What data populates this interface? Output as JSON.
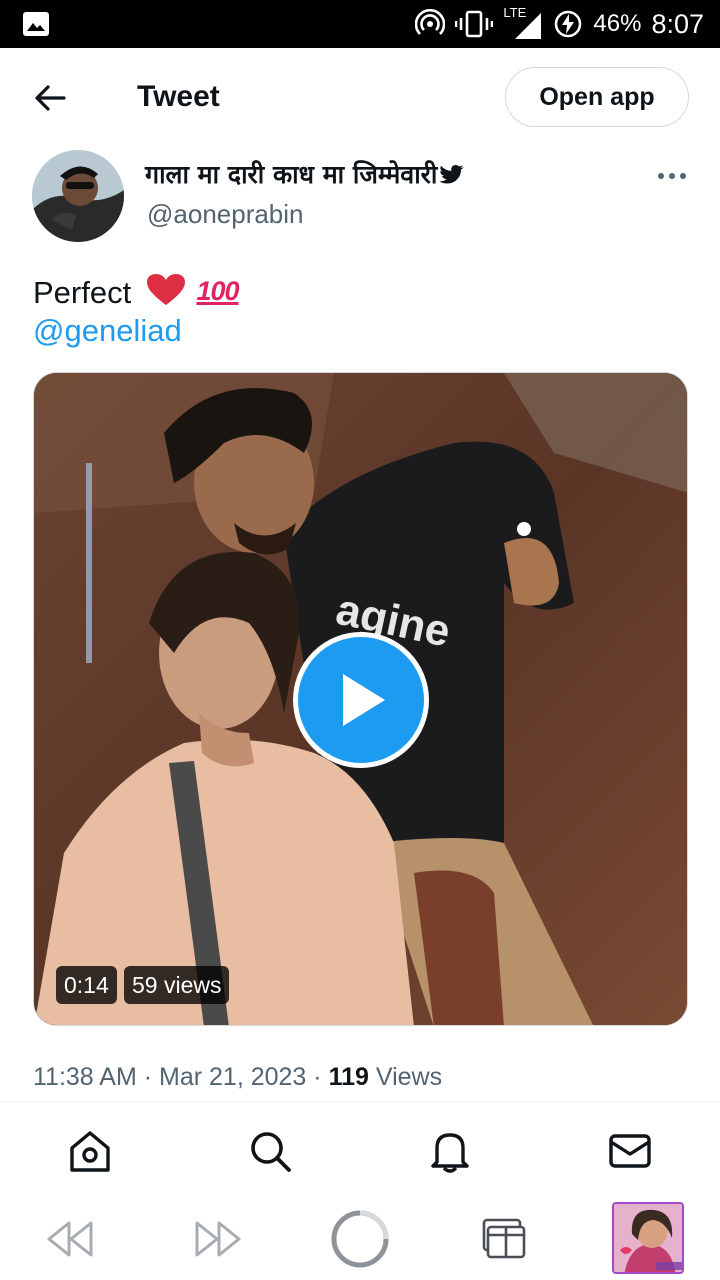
{
  "status_bar": {
    "network": "LTE",
    "battery": "46%",
    "time": "8:07",
    "icons": [
      "image-icon",
      "hotspot-icon",
      "vibrate-icon",
      "signal-icon",
      "battery-charging-icon"
    ]
  },
  "header": {
    "title": "Tweet",
    "open_app_label": "Open app"
  },
  "author": {
    "name": "गाला मा दारी काध मा जिम्मेवारी",
    "handle": "@aoneprabin"
  },
  "tweet": {
    "text": "Perfect",
    "emoji": [
      "heart-emoji",
      "hundred-points-emoji"
    ],
    "hundred_glyph": "100",
    "mention": "@geneliad",
    "media": {
      "type": "video",
      "duration": "0:14",
      "views_label": "59 views"
    },
    "meta": {
      "time": "11:38 AM",
      "separator": "·",
      "date": "Mar 21, 2023",
      "views_count": "119",
      "views_label": "Views"
    }
  },
  "tabbar": [
    "home-icon",
    "search-icon",
    "notifications-icon",
    "messages-icon"
  ],
  "browser_bar": [
    "back-icon",
    "forward-icon",
    "reload-icon",
    "tabs-icon",
    "profile-thumbnail"
  ],
  "colors": {
    "accent": "#1d9bf0",
    "text_primary": "#0f1419",
    "text_secondary": "#536471",
    "border": "#cfd9de",
    "thumb_border": "#a64ac9"
  }
}
